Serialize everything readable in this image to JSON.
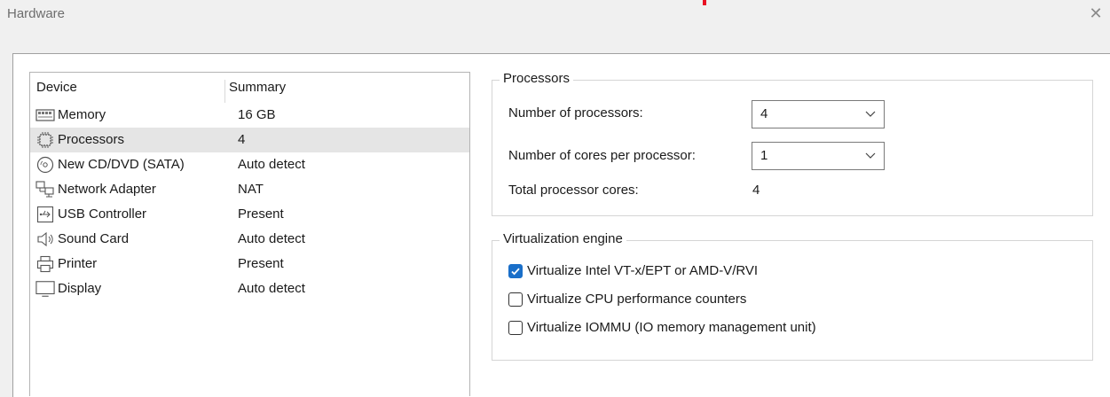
{
  "window": {
    "title": "Hardware",
    "close_glyph": "✕"
  },
  "device_list": {
    "header": {
      "device": "Device",
      "summary": "Summary"
    },
    "selected_index": 1,
    "items": [
      {
        "name": "Memory",
        "summary": "16 GB",
        "icon": "memory-icon"
      },
      {
        "name": "Processors",
        "summary": "4",
        "icon": "processor-icon"
      },
      {
        "name": "New CD/DVD (SATA)",
        "summary": "Auto detect",
        "icon": "cd-dvd-icon"
      },
      {
        "name": "Network Adapter",
        "summary": "NAT",
        "icon": "network-adapter-icon"
      },
      {
        "name": "USB Controller",
        "summary": "Present",
        "icon": "usb-icon"
      },
      {
        "name": "Sound Card",
        "summary": "Auto detect",
        "icon": "sound-card-icon"
      },
      {
        "name": "Printer",
        "summary": "Present",
        "icon": "printer-icon"
      },
      {
        "name": "Display",
        "summary": "Auto detect",
        "icon": "display-icon"
      }
    ]
  },
  "processors": {
    "group_label": "Processors",
    "num_processors_label": "Number of processors:",
    "num_processors_value": "4",
    "cores_label": "Number of cores per processor:",
    "cores_value": "1",
    "total_label": "Total processor cores:",
    "total_value": "4"
  },
  "virtualization": {
    "group_label": "Virtualization engine",
    "options": [
      {
        "label": "Virtualize Intel VT-x/EPT or AMD-V/RVI",
        "checked": true
      },
      {
        "label": "Virtualize CPU performance counters",
        "checked": false
      },
      {
        "label": "Virtualize IOMMU (IO memory management unit)",
        "checked": false
      }
    ]
  },
  "colors": {
    "accent": "#1a6fc9",
    "selected_row": "#e5e5e5",
    "window_bg": "#f0f0f0",
    "close_mark": "#e81123"
  }
}
